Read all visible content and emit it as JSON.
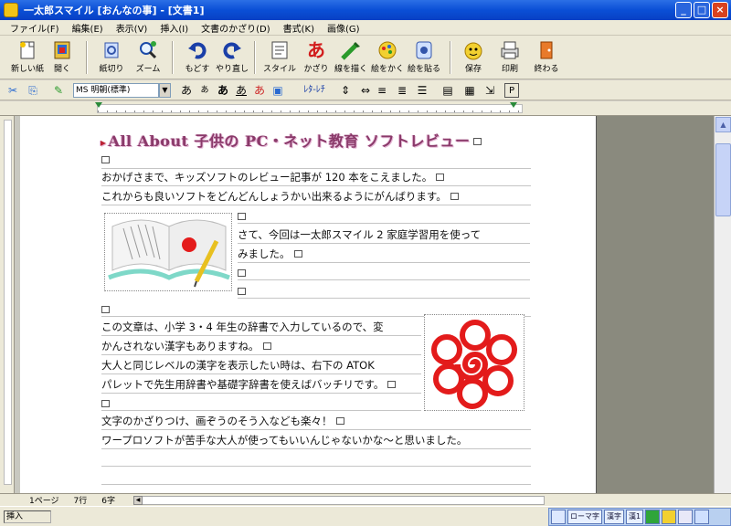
{
  "window": {
    "title": "一太郎スマイル [おんなの事] - [文書1]"
  },
  "menu": [
    "ファイル(F)",
    "編集(E)",
    "表示(V)",
    "挿入(I)",
    "文書のかざり(D)",
    "書式(K)",
    "画像(G)"
  ],
  "toolbar": {
    "buttons": [
      {
        "label": "新しい紙",
        "icon": "new-paper-icon"
      },
      {
        "label": "開く",
        "icon": "open-icon"
      },
      {
        "label": "紙切り",
        "icon": "cut-paper-icon"
      },
      {
        "label": "ズーム",
        "icon": "zoom-icon"
      },
      {
        "label": "もどす",
        "icon": "undo-icon"
      },
      {
        "label": "やり直し",
        "icon": "redo-icon"
      },
      {
        "label": "スタイル",
        "icon": "style-icon"
      },
      {
        "label": "かざり",
        "icon": "decorate-icon"
      },
      {
        "label": "線を描く",
        "icon": "draw-line-icon"
      },
      {
        "label": "絵をかく",
        "icon": "paint-icon"
      },
      {
        "label": "絵を貼る",
        "icon": "paste-picture-icon"
      },
      {
        "label": "保存",
        "icon": "save-icon"
      },
      {
        "label": "印刷",
        "icon": "print-icon"
      },
      {
        "label": "終わる",
        "icon": "exit-icon"
      }
    ]
  },
  "format_toolbar": {
    "font_name": "MS 明朝(標準)"
  },
  "document": {
    "title": "All About 子供の PC・ネット教育 ソフトレビュー",
    "lines": [
      "おかげさまで、キッズソフトのレビュー記事が 120 本をこえました。",
      "これからも良いソフトをどんどんしょうかい出来るようにがんばります。",
      "さて、今回は一太郎スマイル 2 家庭学習用を使って",
      "みました。",
      "この文章は、小学 3・4 年生の辞書で入力しているので、変",
      "かんされない漢字もありますね。",
      "大人と同じレベルの漢字を表示したい時は、右下の ATOK",
      "パレットで先生用辞書や基礎字辞書を使えばバッチリです。",
      "文字のかざりつけ、画ぞうのそう入なども楽々！",
      "ワープロソフトが苦手な大人が使ってもいいんじゃないかな〜と思いました。"
    ]
  },
  "status": {
    "page": "1ページ",
    "line": "7行",
    "column": "6字",
    "message": "挿入",
    "ime": {
      "mode": "ローマ字",
      "dict": "漢字",
      "extra": "漢1"
    }
  },
  "colors": {
    "title_accent": "#8a3a6a",
    "titlebar": "#0a4fd6",
    "flower_red": "#e31b1b"
  }
}
